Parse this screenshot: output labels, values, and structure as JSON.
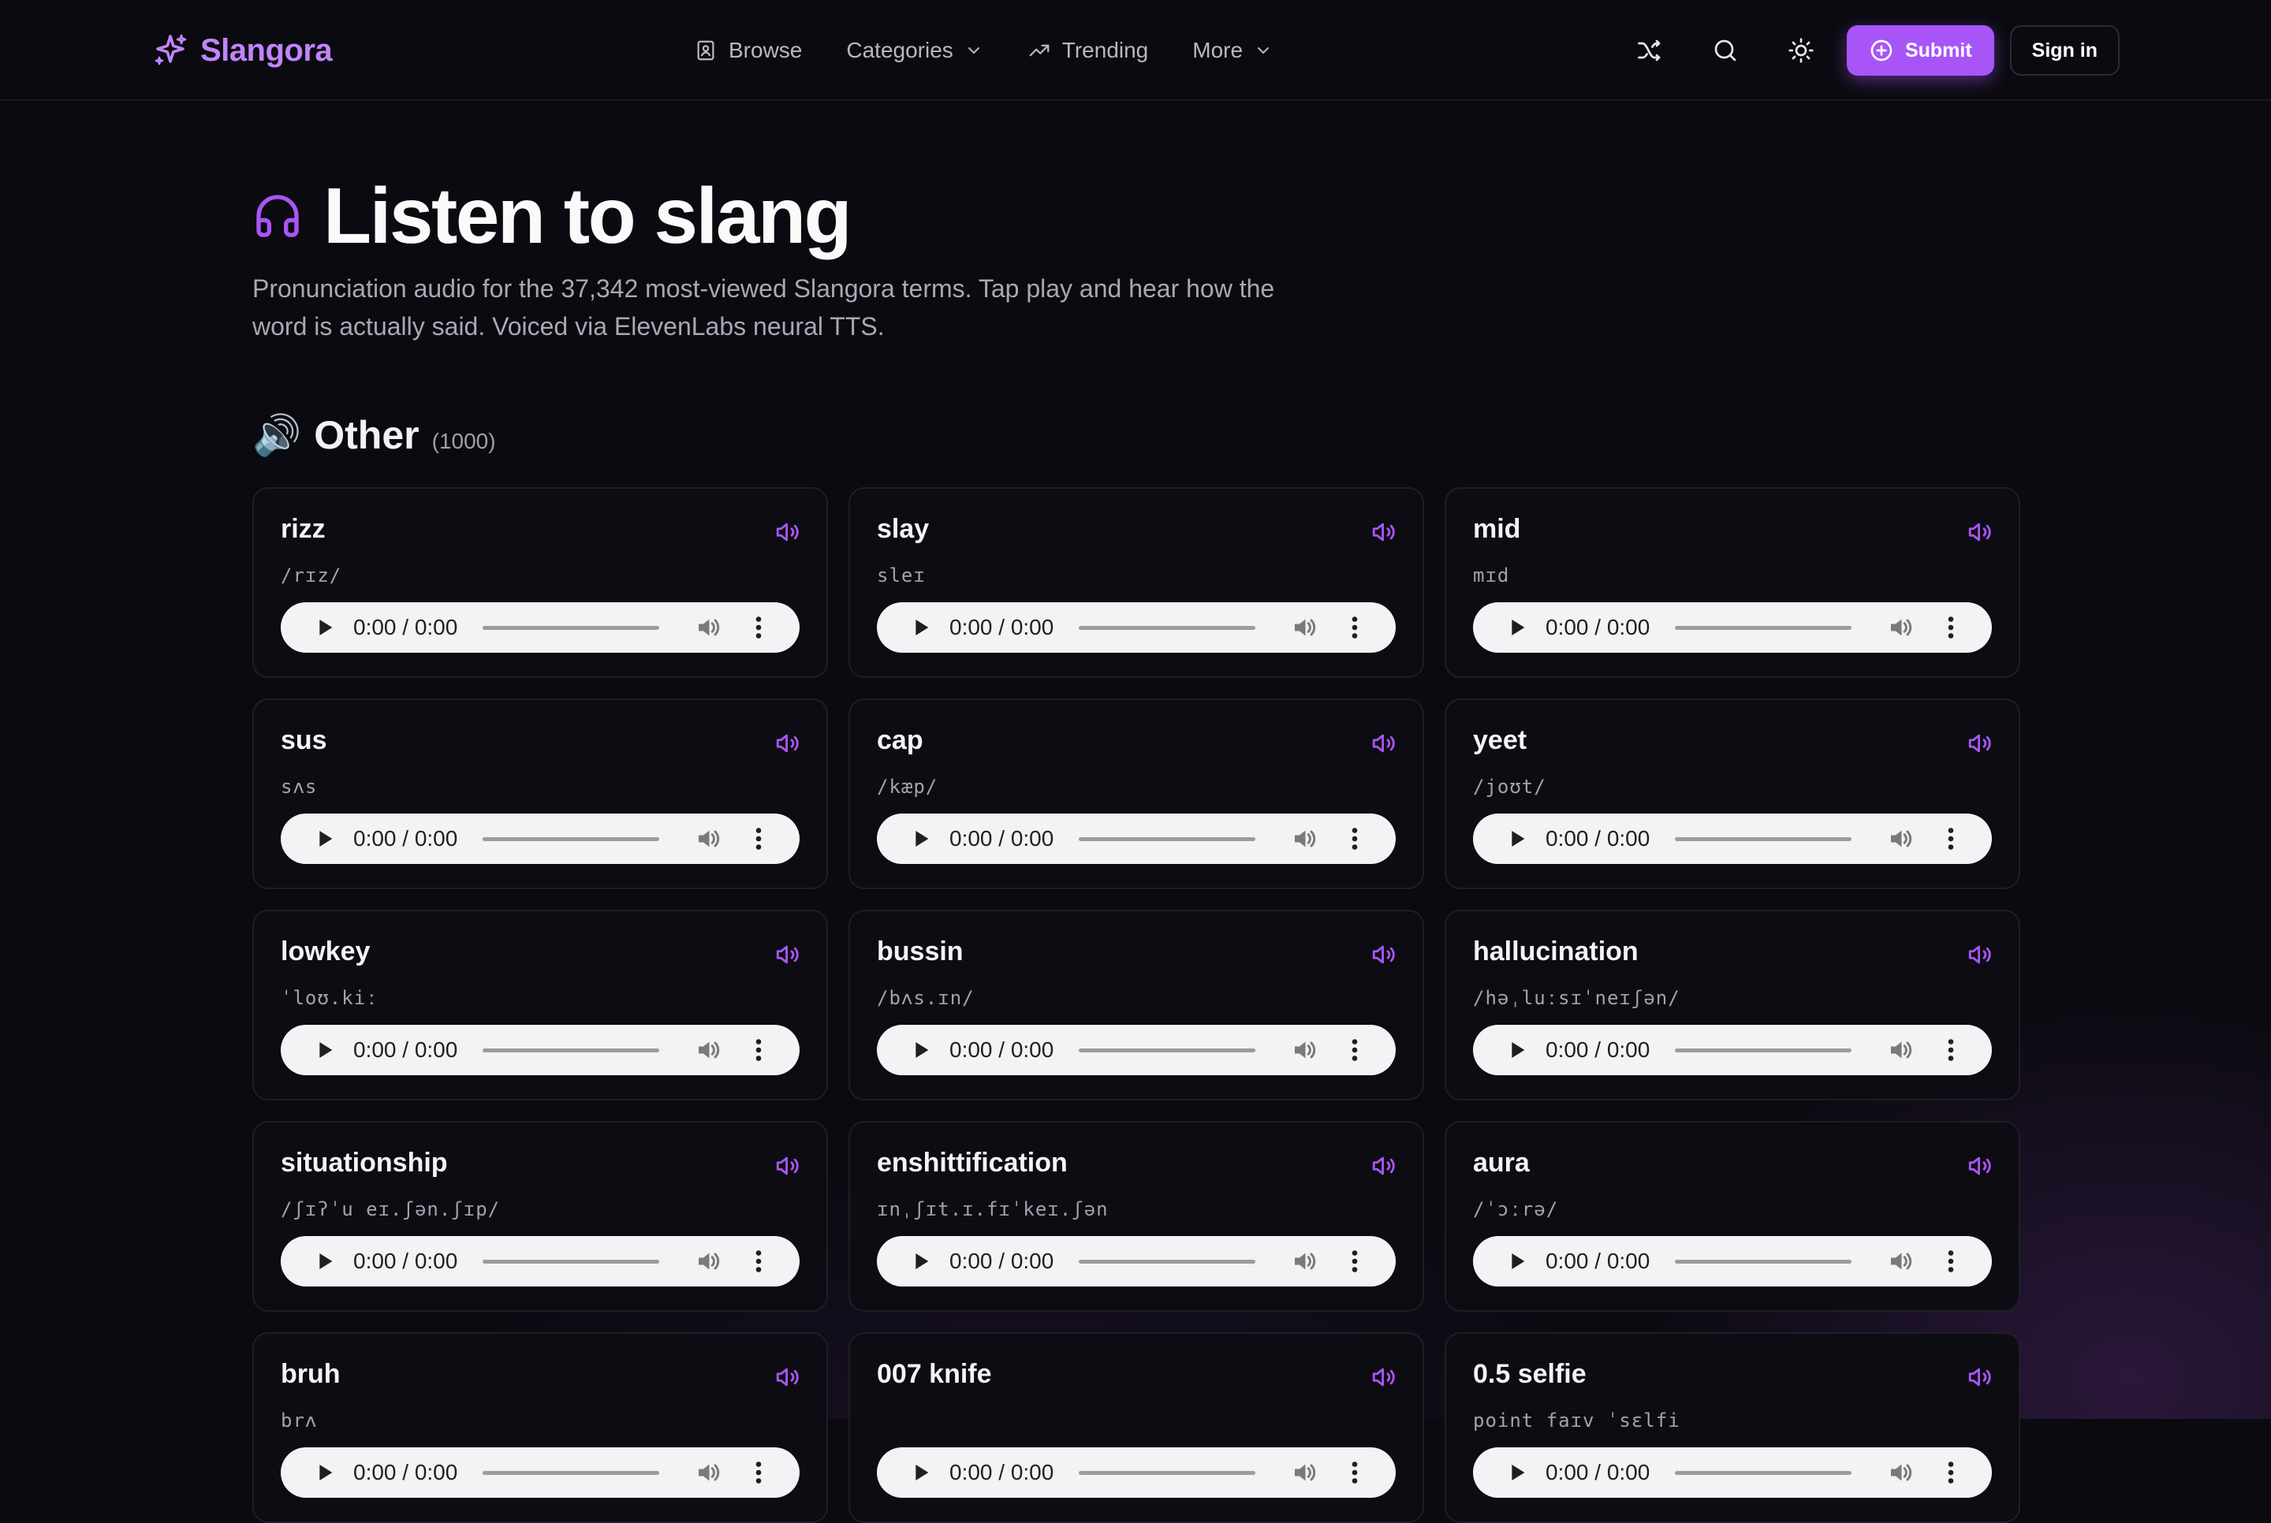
{
  "brand": {
    "name": "Slangora"
  },
  "nav": {
    "browse": "Browse",
    "categories": "Categories",
    "trending": "Trending",
    "more": "More"
  },
  "actions": {
    "submit": "Submit",
    "signin": "Sign in"
  },
  "hero": {
    "title": "Listen to slang",
    "description": "Pronunciation audio for the 37,342 most-viewed Slangora terms. Tap play and hear how the word is actually said. Voiced via ElevenLabs neural TTS."
  },
  "section": {
    "emoji": "🔊",
    "title": "Other",
    "count": "(1000)"
  },
  "player": {
    "time": "0:00 / 0:00"
  },
  "colors": {
    "accent": "#a855f7",
    "brand": "#c084fc",
    "background": "#0b0a10"
  },
  "terms": [
    {
      "term": "rizz",
      "ipa": "/rɪz/"
    },
    {
      "term": "slay",
      "ipa": "sleɪ"
    },
    {
      "term": "mid",
      "ipa": "mɪd"
    },
    {
      "term": "sus",
      "ipa": "sʌs"
    },
    {
      "term": "cap",
      "ipa": "/kæp/"
    },
    {
      "term": "yeet",
      "ipa": "/joʊt/"
    },
    {
      "term": "lowkey",
      "ipa": "ˈloʊ.kiː"
    },
    {
      "term": "bussin",
      "ipa": "/bʌs.ɪn/"
    },
    {
      "term": "hallucination",
      "ipa": "/həˌluːsɪˈneɪʃən/"
    },
    {
      "term": "situationship",
      "ipa": "/ʃɪʔˈu eɪ.ʃən.ʃɪp/"
    },
    {
      "term": "enshittification",
      "ipa": "ɪnˌʃɪt.ɪ.fɪˈkeɪ.ʃən"
    },
    {
      "term": "aura",
      "ipa": "/ˈɔːrə/"
    },
    {
      "term": "bruh",
      "ipa": "brʌ"
    },
    {
      "term": "007 knife",
      "ipa": ""
    },
    {
      "term": "0.5 selfie",
      "ipa": "point faɪv ˈsɛlfi"
    }
  ]
}
